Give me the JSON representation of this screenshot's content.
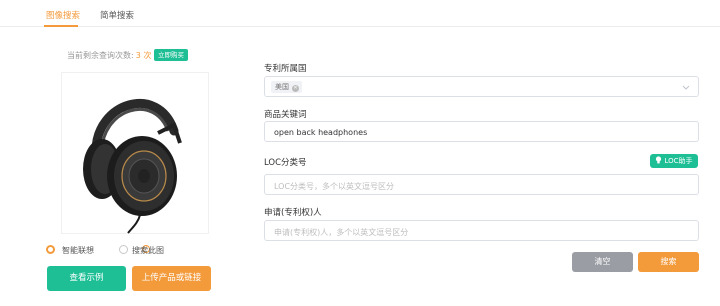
{
  "tabs": [
    {
      "label": "图像搜索",
      "active": true
    },
    {
      "label": "简单搜索",
      "active": false
    }
  ],
  "quota": {
    "label": "当前剩余查询次数:",
    "count": "3 次",
    "buy_label": "立即购买"
  },
  "image_preview": {
    "icon": "headphones-image"
  },
  "options": {
    "smart_association": "智能联想",
    "search_this_image": "搜索此图",
    "selected": "smart_association"
  },
  "left_buttons": {
    "example": "查看示例",
    "upload": "上传产品或链接"
  },
  "form": {
    "country": {
      "label": "专利所属国",
      "tags": [
        "美国"
      ]
    },
    "keywords": {
      "label": "商品关键词",
      "value": "open back headphones"
    },
    "loc": {
      "label": "LOC分类号",
      "placeholder": "LOC分类号，多个以英文逗号区分",
      "helper_label": "LOC助手"
    },
    "applicant": {
      "label": "申请(专利权)人",
      "placeholder": "申请(专利权)人，多个以英文逗号区分"
    }
  },
  "actions": {
    "clear": "清空",
    "search": "搜索"
  },
  "colors": {
    "accent_orange": "#f39a3b",
    "accent_green": "#1fbf96",
    "button_gray": "#9a9da3"
  }
}
